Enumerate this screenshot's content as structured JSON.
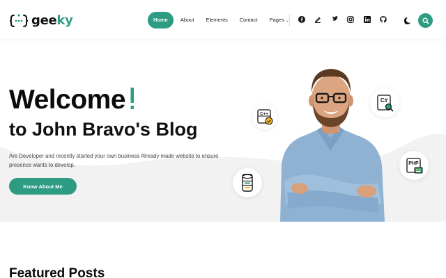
{
  "header": {
    "logo": {
      "prefix": "gee",
      "accent": "ky"
    },
    "nav": {
      "home": "Home",
      "about": "About",
      "elements": "Elements",
      "contact": "Contact",
      "pages": "Pages"
    },
    "social_icons": [
      "facebook-icon",
      "pen-icon",
      "twitter-icon",
      "instagram-icon",
      "linkedin-icon",
      "github-icon"
    ],
    "theme_icon": "moon-icon",
    "search_icon": "search-icon"
  },
  "hero": {
    "title": "Welcome",
    "subtitle": "to John Bravo's Blog",
    "description": "Are Developer and recently started your own business Already made website to ensure presence wants to develop.",
    "cta_label": "Know About Me",
    "badges": {
      "cpp": "C++",
      "csharp": "C#",
      "php": "PHP"
    }
  },
  "featured": {
    "heading": "Featured Posts"
  },
  "colors": {
    "accent": "#2d9c82",
    "text": "#111111",
    "background": "#ffffff",
    "hero_wave": "#f2f2f2"
  }
}
